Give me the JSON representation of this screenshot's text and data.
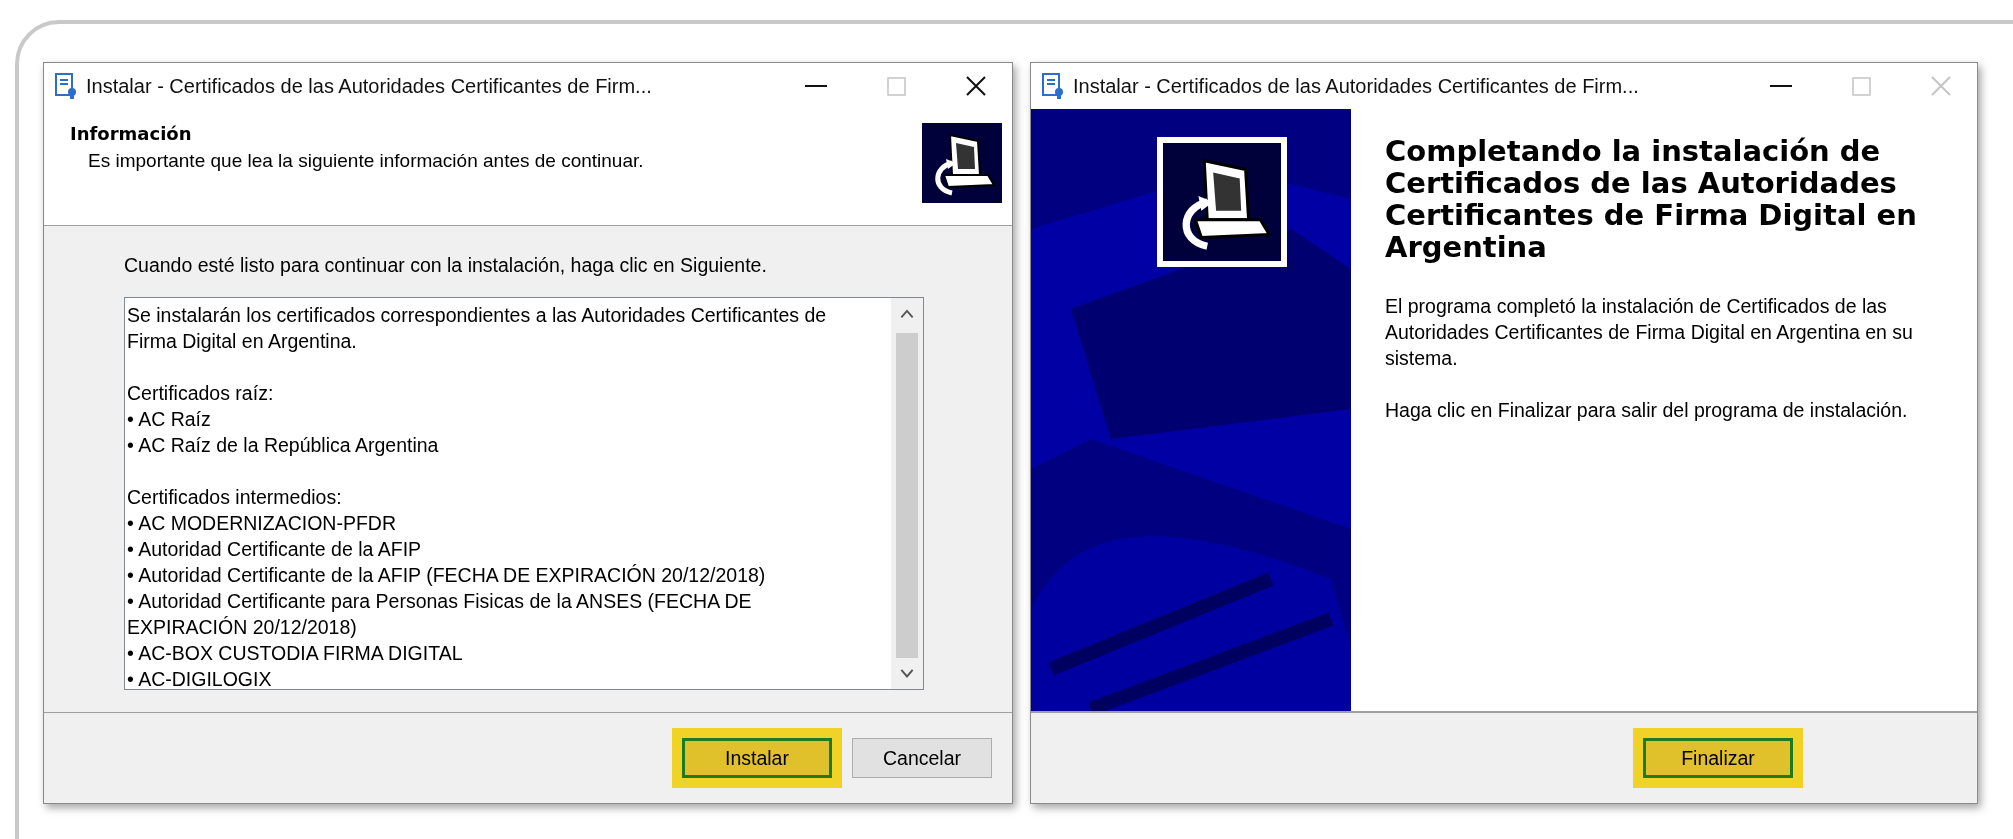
{
  "windows": [
    {
      "kind": "info",
      "title": "Instalar - Certificados de las Autoridades Certificantes de Firm...",
      "title_buttons": [
        {
          "kind": "minimize",
          "disabled": false
        },
        {
          "kind": "maximize",
          "disabled": true
        },
        {
          "kind": "close",
          "disabled": false
        }
      ],
      "header": {
        "title": "Información",
        "subtitle": "Es importante que lea la siguiente información antes de continuar."
      },
      "instruction": "Cuando esté listo para continuar con la instalación, haga clic en Siguiente.",
      "memo": [
        [
          "Se instalarán los certificados correspondientes a las Autoridades Certificantes de",
          "Firma Digital en Argentina."
        ],
        [
          "Certificados raíz:",
          "• AC Raíz",
          "• AC Raíz de la República Argentina"
        ],
        [
          "Certificados intermedios:",
          "• AC MODERNIZACION-PFDR",
          "• Autoridad Certificante de la AFIP",
          "• Autoridad Certificante de la AFIP (FECHA DE EXPIRACIÓN 20/12/2018)",
          "• Autoridad Certificante para Personas Fisicas de la ANSES (FECHA DE",
          "EXPIRACIÓN 20/12/2018)",
          "• AC-BOX CUSTODIA FIRMA DIGITAL",
          "• AC-DIGILOGIX"
        ]
      ],
      "buttons": [
        {
          "label": "Instalar",
          "highlighted": true
        },
        {
          "label": "Cancelar",
          "highlighted": false
        }
      ]
    },
    {
      "kind": "finish",
      "title": "Instalar - Certificados de las Autoridades Certificantes de Firm...",
      "title_buttons": [
        {
          "kind": "minimize",
          "disabled": false
        },
        {
          "kind": "maximize",
          "disabled": true
        },
        {
          "kind": "close",
          "disabled": true
        }
      ],
      "heading": "Completando la instalación de Certificados de las Autoridades Certificantes de Firma Digital en Argentina",
      "paragraphs": [
        "El programa completó la instalación de Certificados de las Autoridades Certificantes de Firma Digital en Argentina en su sistema.",
        "Haga clic en Finalizar para salir del programa de instalación."
      ],
      "buttons": [
        {
          "label": "Finalizar",
          "highlighted": true
        }
      ]
    }
  ]
}
